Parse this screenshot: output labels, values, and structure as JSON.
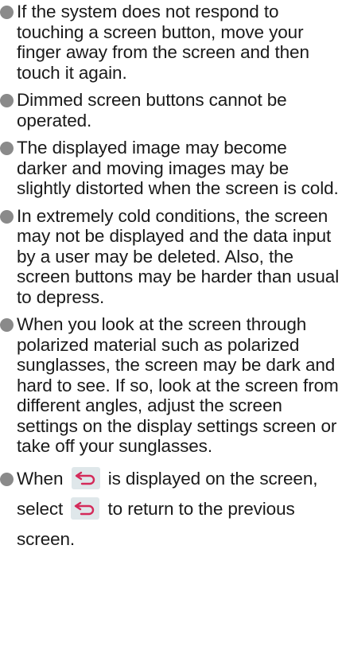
{
  "notes": [
    {
      "text": "If the system does not respond to touching a screen button, move your finger away from the screen and then touch it again."
    },
    {
      "text": "Dimmed screen buttons cannot be operated."
    },
    {
      "text": "The displayed image may become darker and moving images may be slightly distorted when the screen is cold."
    },
    {
      "text": "In extremely cold conditions, the screen may not be displayed and the data input by a user may be deleted. Also, the screen buttons may be harder than usual to depress."
    },
    {
      "text": "When you look at the screen through polarized material such as polarized sunglasses, the screen may be dark and hard to see. If so, look at the screen from different angles, adjust the screen settings on the display settings screen or take off your sunglasses."
    }
  ],
  "back_note": {
    "part1": "When",
    "part2": "is displayed on the screen, select",
    "part3": "to return to the previous screen.",
    "icon": "back-arrow-icon"
  },
  "colors": {
    "bullet": "#8a8a8a",
    "icon_bg": "#dfe7ea",
    "icon_arrow": "#d42a5a",
    "text": "#1a1a1a"
  }
}
